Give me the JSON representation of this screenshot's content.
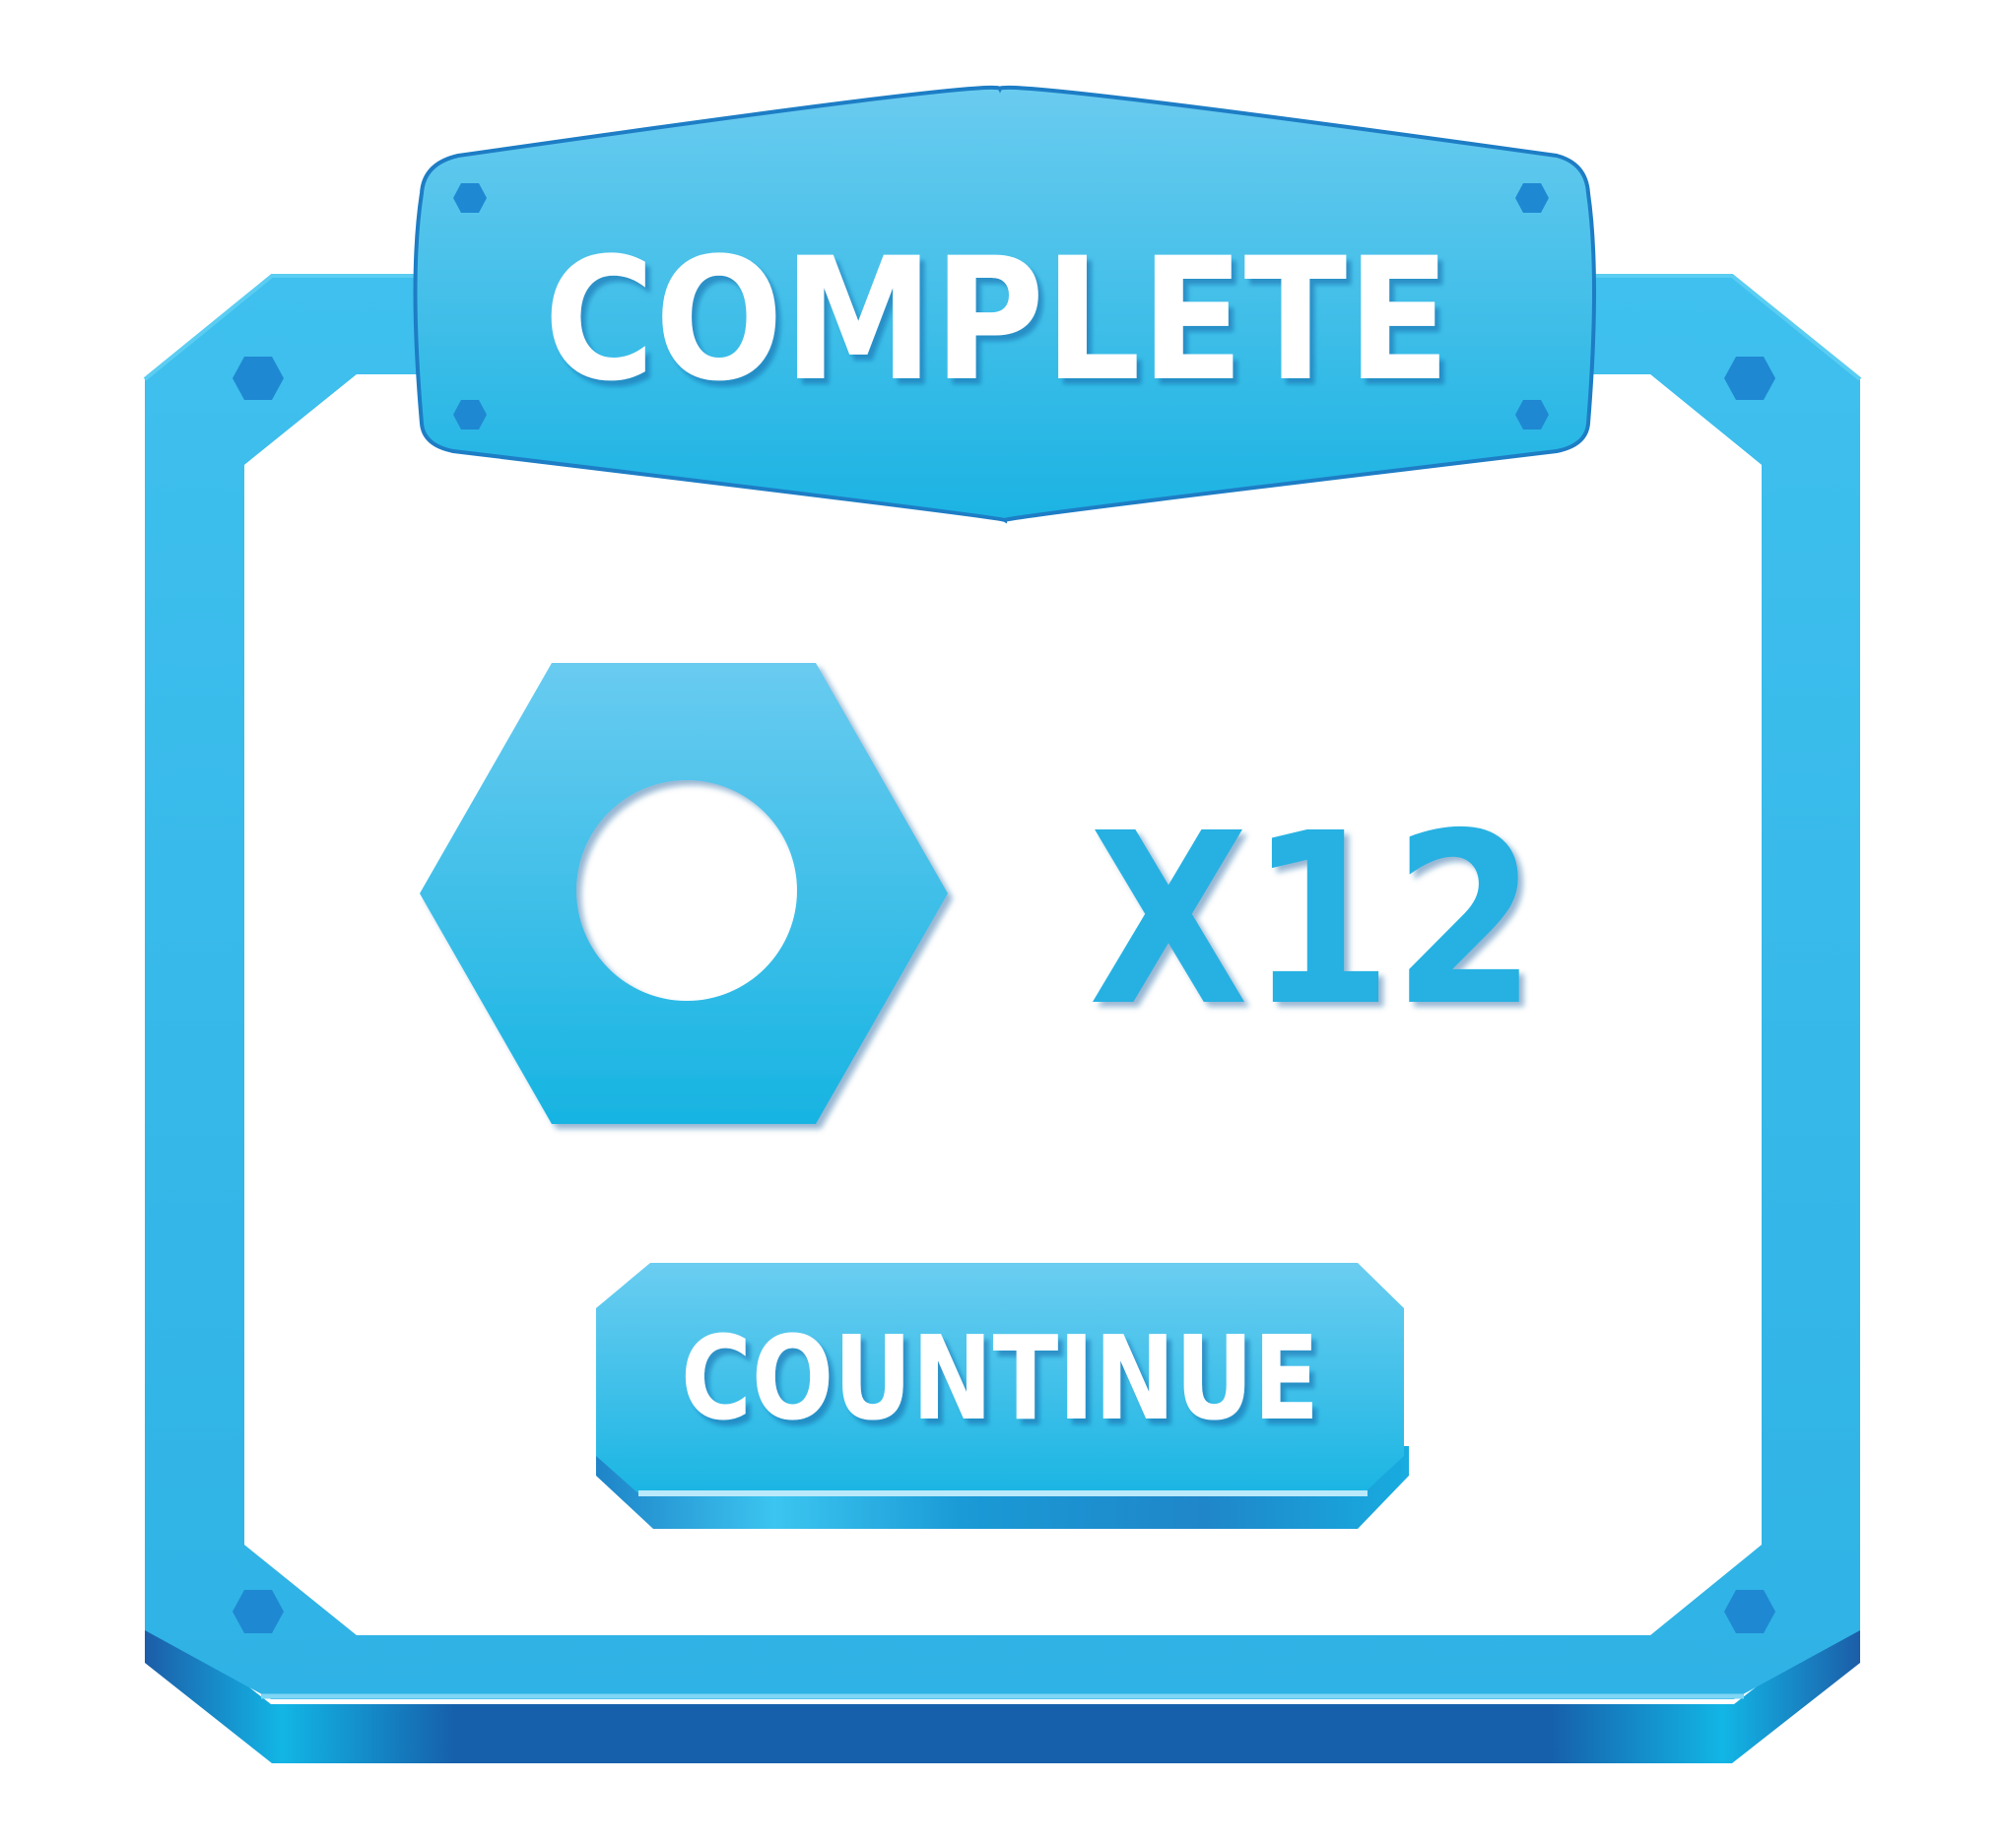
{
  "title": "COMPLETE",
  "reward": {
    "icon": "hex-nut-icon",
    "quantity": "X12"
  },
  "button": {
    "label": "COUNTINUE"
  },
  "colors": {
    "frame_light": "#63c9ef",
    "frame_mid": "#2fb4e6",
    "frame_dark": "#1d62ad",
    "frame_edge": "#1e7fc6",
    "bolt": "#1f88d2",
    "panel": "#ffffff",
    "quantity_text": "#26b1e2",
    "title_text": "#ffffff"
  }
}
